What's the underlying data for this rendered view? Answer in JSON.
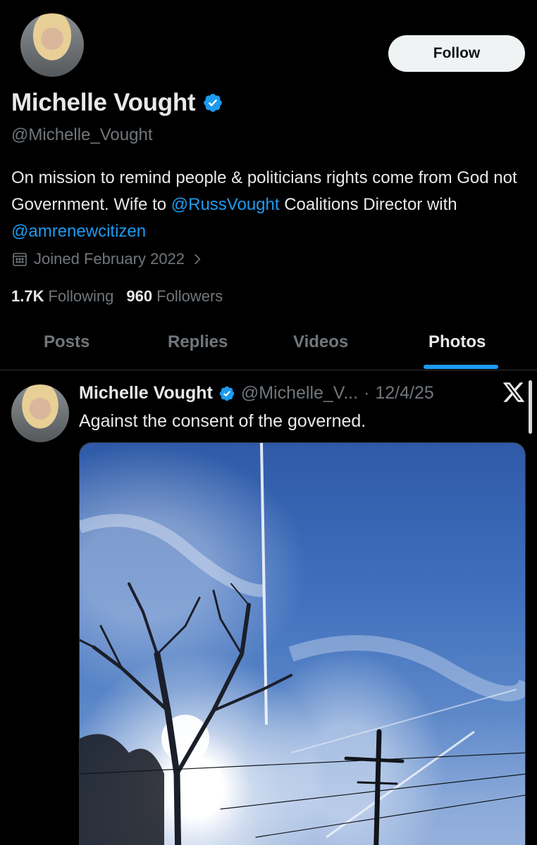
{
  "profile": {
    "display_name": "Michelle Vought",
    "handle": "@Michelle_Vought",
    "bio_part1": "On mission to remind people & politicians rights come from God not Government. Wife to ",
    "bio_mention1": "@RussVought",
    "bio_part2": " Coalitions Director with ",
    "bio_mention2": "@amrenewcitizen",
    "joined": "Joined February 2022",
    "following_count": "1.7K",
    "following_label": "Following",
    "followers_count": "960",
    "followers_label": "Followers"
  },
  "actions": {
    "follow_label": "Follow"
  },
  "tabs": [
    {
      "label": "Posts",
      "active": false
    },
    {
      "label": "Replies",
      "active": false
    },
    {
      "label": "Videos",
      "active": false
    },
    {
      "label": "Photos",
      "active": true
    }
  ],
  "tweet": {
    "name": "Michelle Vought",
    "handle": "@Michelle_V...",
    "separator": "·",
    "date": "12/4/25",
    "text": "Against the consent of the governed."
  },
  "colors": {
    "background": "#000000",
    "text_primary": "#e7e9ea",
    "text_secondary": "#71767b",
    "accent": "#1d9bf0",
    "follow_button_bg": "#eff3f4"
  },
  "icons": {
    "verified": "verified-badge-icon",
    "calendar": "calendar-icon",
    "chevron": "chevron-right-icon",
    "platform": "x-logo-icon"
  }
}
